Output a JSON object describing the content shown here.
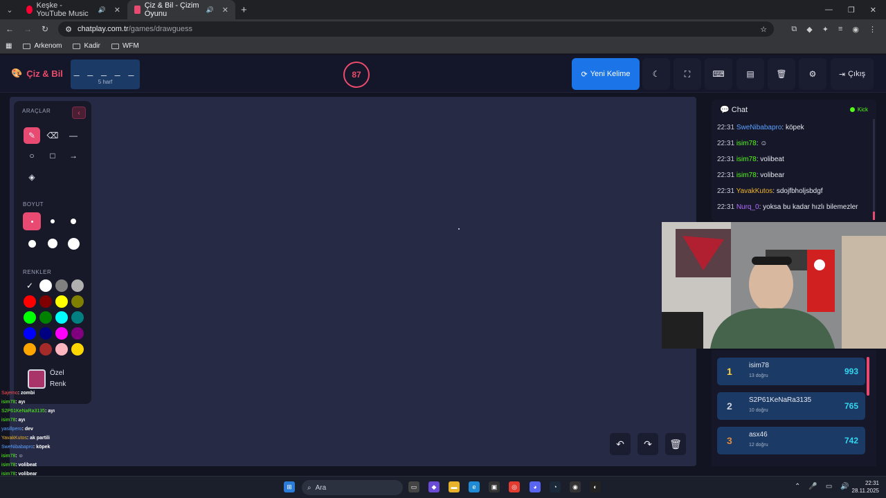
{
  "browser": {
    "tabs": [
      {
        "title": "Keşke - YouTube Music",
        "favicon_color": "#ff0033"
      },
      {
        "title": "Çiz & Bil - Çizim Oyunu",
        "favicon_color": "#e84a72"
      }
    ],
    "url_host": "chatplay.com.tr",
    "url_path": "/games/drawguess",
    "bookmarks": [
      "Arkenom",
      "Kadir",
      "WFM"
    ]
  },
  "header": {
    "brand": "Çiz & Bil",
    "word_mask": "_ _ _ _ _",
    "word_hint": "5 harf",
    "timer": "87",
    "new_word_label": "Yeni Kelime",
    "exit_label": "Çıkış"
  },
  "tools": {
    "section_tools": "ARAÇLAR",
    "section_size": "BOYUT",
    "section_colors": "RENKLER",
    "custom_color_label_1": "Özel",
    "custom_color_label_2": "Renk",
    "custom_color": "#a8346a",
    "palette": [
      "#ffffff",
      "#ffffff",
      "#808080",
      "#b0b0b0",
      "#ff0000",
      "#800000",
      "#ffff00",
      "#808000",
      "#00ff00",
      "#008000",
      "#00ffff",
      "#008080",
      "#0000ff",
      "#000080",
      "#ff00ff",
      "#800080",
      "#ffa500",
      "#a52a2a",
      "#ffb6c1",
      "#ffd700"
    ]
  },
  "chat": {
    "title": "Chat",
    "platform": "Kick",
    "messages": [
      {
        "time": "22:31",
        "user": "SweNibabapro",
        "color": "#5aa0ff",
        "text": ": köpek"
      },
      {
        "time": "22:31",
        "user": "isim78",
        "color": "#53fc18",
        "text": ": ☺"
      },
      {
        "time": "22:31",
        "user": "isim78",
        "color": "#53fc18",
        "text": ": volibeat"
      },
      {
        "time": "22:31",
        "user": "isim78",
        "color": "#53fc18",
        "text": ": volibear"
      },
      {
        "time": "22:31",
        "user": "YavakKutos",
        "color": "#f0b429",
        "text": ": sdojfbholjsbdgf"
      },
      {
        "time": "22:31",
        "user": "Nurq_0",
        "color": "#b36cff",
        "text": ": yoksa bu kadar hızlı bilemezler"
      }
    ]
  },
  "leaderboard": [
    {
      "rank": "1",
      "name": "isim78",
      "stat": "13 doğru",
      "points": "993",
      "rank_color": "#ffd43b"
    },
    {
      "rank": "2",
      "name": "S2P61KeNaRa3135",
      "stat": "10 doğru",
      "points": "765",
      "rank_color": "#cfd4dc"
    },
    {
      "rank": "3",
      "name": "asx46",
      "stat": "12 doğru",
      "points": "742",
      "rank_color": "#e08a3c"
    }
  ],
  "overlay_chat": [
    {
      "user": "Sajemo",
      "text": ": zombi",
      "color": "#ff4d4d"
    },
    {
      "user": "isim78",
      "text": ": ayı",
      "color": "#53fc18"
    },
    {
      "user": "S2P61KeNaRa3135",
      "text": ": ayı",
      "color": "#53fc18"
    },
    {
      "user": "isim78",
      "text": ": ayı",
      "color": "#53fc18"
    },
    {
      "user": "yasillpero",
      "text": ": dev",
      "color": "#5aa0ff"
    },
    {
      "user": "YavakKutos",
      "text": ": ak partili",
      "color": "#f0b429"
    },
    {
      "user": "SweNibabapro",
      "text": ": köpek",
      "color": "#5aa0ff"
    },
    {
      "user": "isim78",
      "text": ": ☺",
      "color": "#53fc18"
    },
    {
      "user": "isim78",
      "text": ": volibeat",
      "color": "#53fc18"
    },
    {
      "user": "isim78",
      "text": ": volibear",
      "color": "#53fc18"
    },
    {
      "user": "YavakKutos",
      "text": ": sdojfbholjsbdgf",
      "color": "#f0b429"
    },
    {
      "user": "Nurq_0",
      "text": ": yoksa bu kadar hızlı bilemezler",
      "color": "#b36cff"
    }
  ],
  "taskbar": {
    "search_placeholder": "Ara",
    "time": "22:31",
    "date": "28.11.2025"
  }
}
